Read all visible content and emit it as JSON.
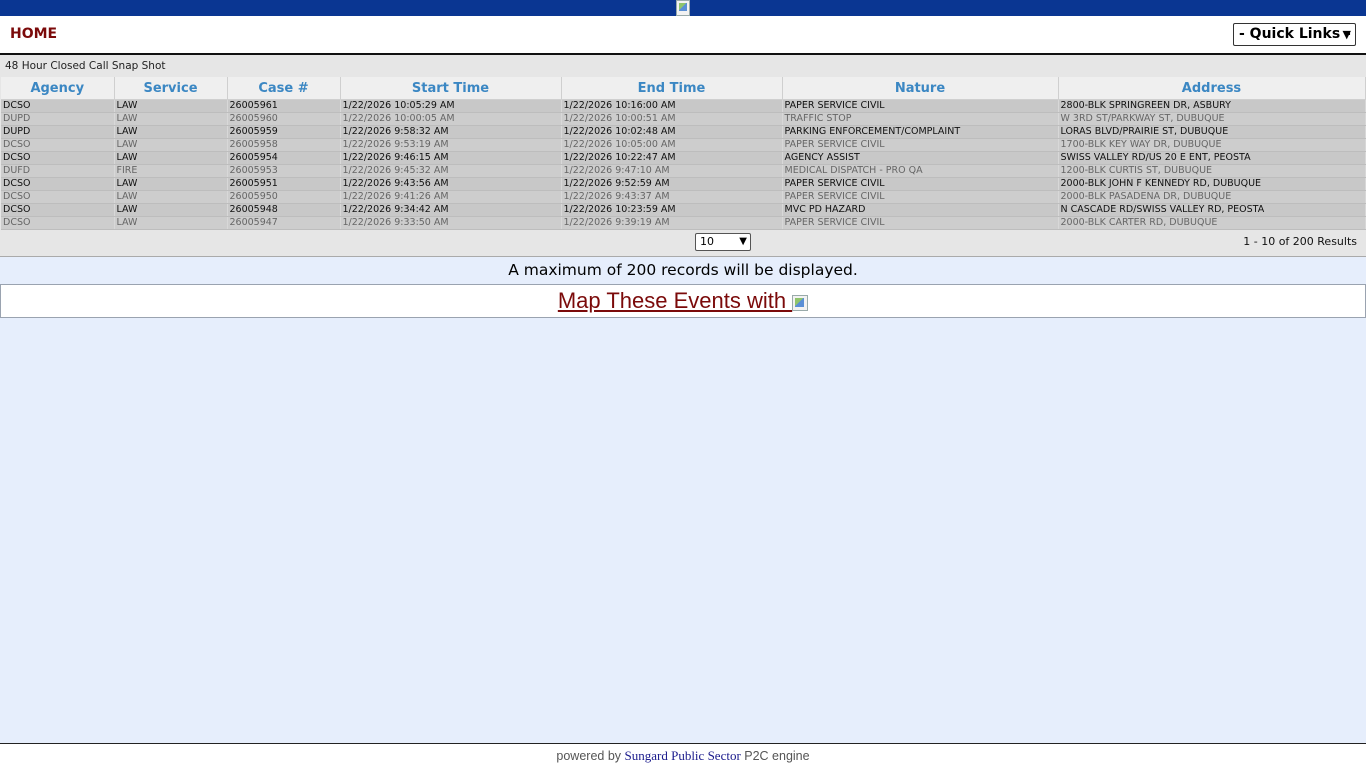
{
  "header": {
    "home_label": "HOME",
    "quick_links_label": "- Quick Links -"
  },
  "panel": {
    "title": "48 Hour Closed Call Snap Shot",
    "columns": [
      "Agency",
      "Service",
      "Case #",
      "Start Time",
      "End Time",
      "Nature",
      "Address"
    ],
    "rows": [
      [
        "DCSO",
        "LAW",
        "26005961",
        "1/22/2026 10:05:29 AM",
        "1/22/2026 10:16:00 AM",
        "PAPER SERVICE CIVIL",
        "2800-BLK SPRINGREEN DR, ASBURY"
      ],
      [
        "DUPD",
        "LAW",
        "26005960",
        "1/22/2026 10:00:05 AM",
        "1/22/2026 10:00:51 AM",
        "TRAFFIC STOP",
        "W 3RD ST/PARKWAY ST, DUBUQUE"
      ],
      [
        "DUPD",
        "LAW",
        "26005959",
        "1/22/2026 9:58:32 AM",
        "1/22/2026 10:02:48 AM",
        "PARKING ENFORCEMENT/COMPLAINT",
        "LORAS BLVD/PRAIRIE ST, DUBUQUE"
      ],
      [
        "DCSO",
        "LAW",
        "26005958",
        "1/22/2026 9:53:19 AM",
        "1/22/2026 10:05:00 AM",
        "PAPER SERVICE CIVIL",
        "1700-BLK KEY WAY DR, DUBUQUE"
      ],
      [
        "DCSO",
        "LAW",
        "26005954",
        "1/22/2026 9:46:15 AM",
        "1/22/2026 10:22:47 AM",
        "AGENCY ASSIST",
        "SWISS VALLEY RD/US 20 E ENT, PEOSTA"
      ],
      [
        "DUFD",
        "FIRE",
        "26005953",
        "1/22/2026 9:45:32 AM",
        "1/22/2026 9:47:10 AM",
        "MEDICAL DISPATCH - PRO QA",
        "1200-BLK CURTIS ST, DUBUQUE"
      ],
      [
        "DCSO",
        "LAW",
        "26005951",
        "1/22/2026 9:43:56 AM",
        "1/22/2026 9:52:59 AM",
        "PAPER SERVICE CIVIL",
        "2000-BLK JOHN F KENNEDY RD, DUBUQUE"
      ],
      [
        "DCSO",
        "LAW",
        "26005950",
        "1/22/2026 9:41:26 AM",
        "1/22/2026 9:43:37 AM",
        "PAPER SERVICE CIVIL",
        "2000-BLK PASADENA DR, DUBUQUE"
      ],
      [
        "DCSO",
        "LAW",
        "26005948",
        "1/22/2026 9:34:42 AM",
        "1/22/2026 10:23:59 AM",
        "MVC PD HAZARD",
        "N CASCADE RD/SWISS VALLEY RD, PEOSTA"
      ],
      [
        "DCSO",
        "LAW",
        "26005947",
        "1/22/2026 9:33:50 AM",
        "1/22/2026 9:39:19 AM",
        "PAPER SERVICE CIVIL",
        "2000-BLK CARTER RD, DUBUQUE"
      ]
    ],
    "page_size": "10",
    "results_text": "1 - 10 of 200 Results"
  },
  "notice": "A maximum of 200 records will be displayed.",
  "map_link_label": "Map These Events with ",
  "footer": {
    "prefix": "powered by ",
    "vendor": "Sungard Public Sector",
    "suffix": " P2C engine"
  },
  "colors": {
    "top_bar": "#0a3692",
    "page_background": "#e6eefc",
    "link_dark_red": "#7b0a0a",
    "column_header_blue": "#3b87c3"
  },
  "icons": [
    "broken-image-icon",
    "chevron-down-icon"
  ]
}
